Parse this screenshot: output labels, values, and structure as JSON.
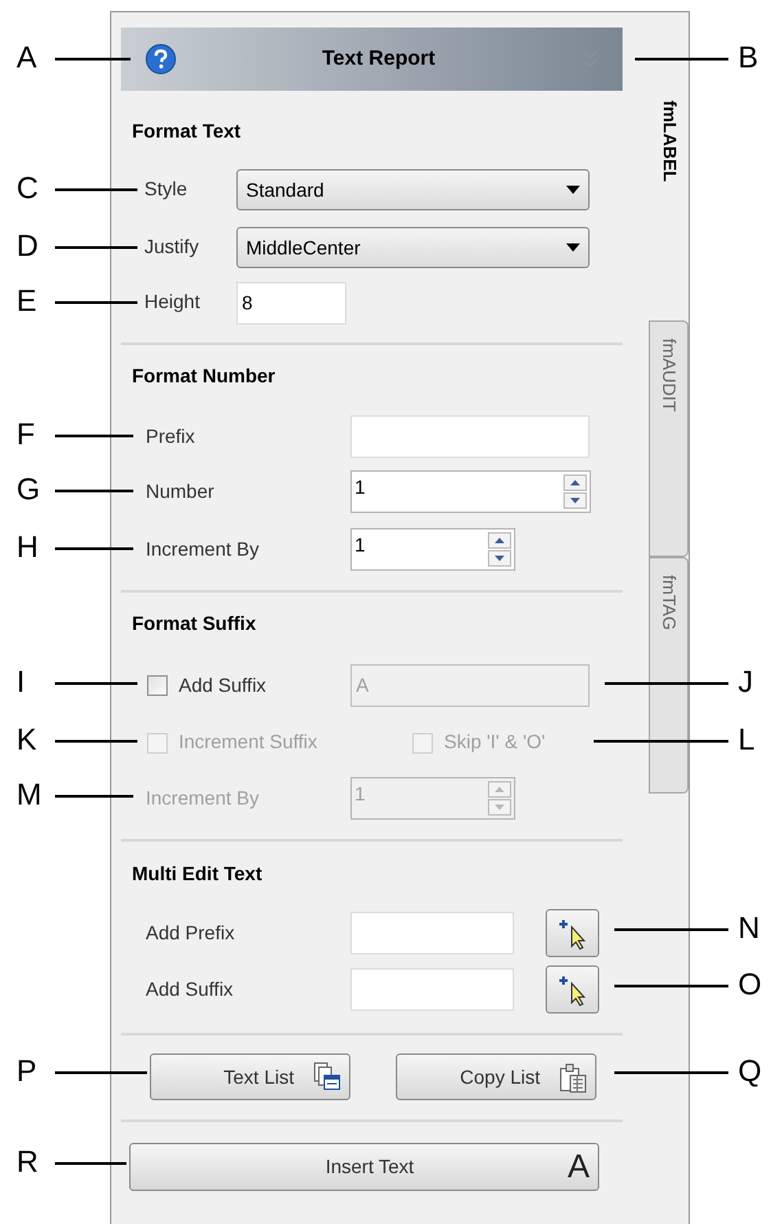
{
  "header": {
    "title": "Text Report"
  },
  "tabs": [
    {
      "label": "fmLABEL",
      "selected": true
    },
    {
      "label": "fmAUDIT",
      "selected": false
    },
    {
      "label": "fmTAG",
      "selected": false
    }
  ],
  "format_text": {
    "heading": "Format Text",
    "style": {
      "label": "Style",
      "value": "Standard"
    },
    "justify": {
      "label": "Justify",
      "value": "MiddleCenter"
    },
    "height": {
      "label": "Height",
      "value": "8"
    }
  },
  "format_number": {
    "heading": "Format Number",
    "prefix": {
      "label": "Prefix"
    },
    "number": {
      "label": "Number",
      "value": "1"
    },
    "increment_by": {
      "label": "Increment By",
      "value": "1"
    }
  },
  "format_suffix": {
    "heading": "Format Suffix",
    "add_suffix": {
      "label": "Add Suffix",
      "checked": false
    },
    "suffix_field": {
      "value": "A",
      "disabled": true
    },
    "increment_suffix": {
      "label": "Increment Suffix",
      "checked": false,
      "disabled": true
    },
    "skip_io": {
      "label": "Skip 'I' & 'O'",
      "checked": false,
      "disabled": true
    },
    "increment_by": {
      "label": "Increment By",
      "value": "1",
      "disabled": true
    }
  },
  "multi_edit": {
    "heading": "Multi Edit Text",
    "rows": [
      {
        "label": "Add Prefix"
      },
      {
        "label": "Add Suffix"
      }
    ]
  },
  "buttons": [
    {
      "label": "Text List",
      "kind": "list"
    },
    {
      "label": "Copy List",
      "kind": "clipboard"
    }
  ],
  "insert_button": {
    "label": "Insert Text",
    "glyph": "A"
  },
  "callouts": [
    {
      "letter": "A",
      "kind": "left"
    },
    {
      "letter": "B",
      "kind": "right"
    },
    {
      "letter": "C",
      "kind": "left"
    },
    {
      "letter": "D",
      "kind": "left"
    },
    {
      "letter": "E",
      "kind": "left"
    },
    {
      "letter": "F",
      "kind": "left"
    },
    {
      "letter": "G",
      "kind": "left"
    },
    {
      "letter": "H",
      "kind": "left"
    },
    {
      "letter": "I",
      "kind": "left"
    },
    {
      "letter": "J",
      "kind": "right"
    },
    {
      "letter": "K",
      "kind": "left"
    },
    {
      "letter": "L",
      "kind": "right"
    },
    {
      "letter": "M",
      "kind": "left"
    },
    {
      "letter": "N",
      "kind": "right"
    },
    {
      "letter": "O",
      "kind": "right"
    },
    {
      "letter": "P",
      "kind": "left"
    },
    {
      "letter": "Q",
      "kind": "right"
    },
    {
      "letter": "R",
      "kind": "left"
    }
  ]
}
